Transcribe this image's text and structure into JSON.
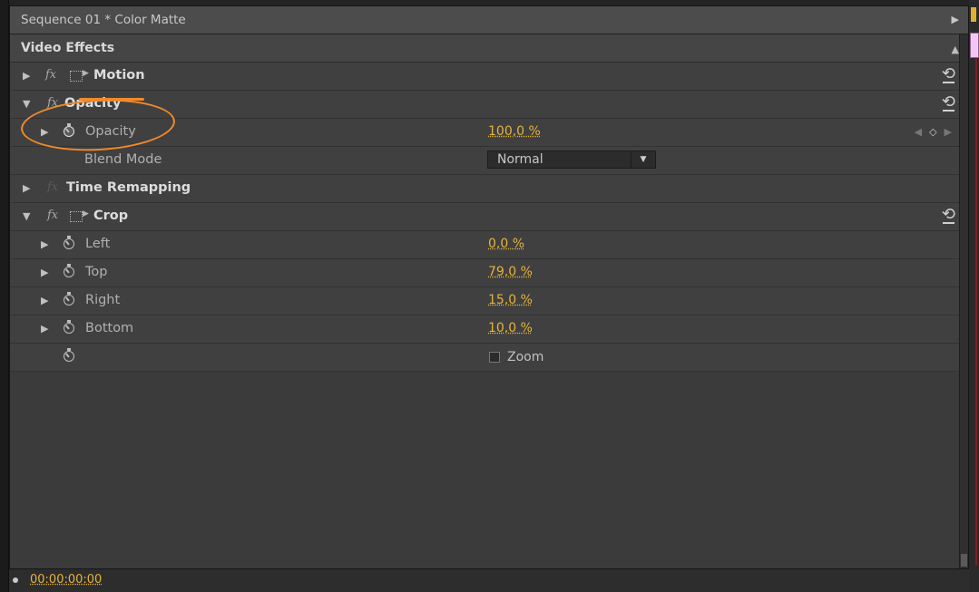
{
  "sequence_title": "Sequence 01 * Color Matte",
  "section": {
    "title": "Video Effects"
  },
  "effects": {
    "motion": {
      "name": "Motion"
    },
    "opacity": {
      "name": "Opacity",
      "param_label": "Opacity",
      "param_value": "100,0 %",
      "blend_label": "Blend Mode",
      "blend_value": "Normal"
    },
    "time_remapping": {
      "name": "Time Remapping"
    },
    "crop": {
      "name": "Crop",
      "params": [
        {
          "label": "Left",
          "value": "0,0 %"
        },
        {
          "label": "Top",
          "value": "79,0 %"
        },
        {
          "label": "Right",
          "value": "15,0 %"
        },
        {
          "label": "Bottom",
          "value": "10,0 %"
        }
      ],
      "zoom_label": "Zoom",
      "zoom_checked": false
    }
  },
  "timecode": "00:00:00:00",
  "colors": {
    "value_accent": "#e5b33b",
    "annotation": "#f08a2a",
    "panel_bg": "#3b3b3b"
  },
  "icons": {
    "fx": "fx-icon",
    "stopwatch": "stopwatch-icon",
    "reset": "reset-icon",
    "motion": "motion-transform-icon",
    "expand": "triangle-right-icon",
    "collapse": "triangle-down-icon"
  }
}
